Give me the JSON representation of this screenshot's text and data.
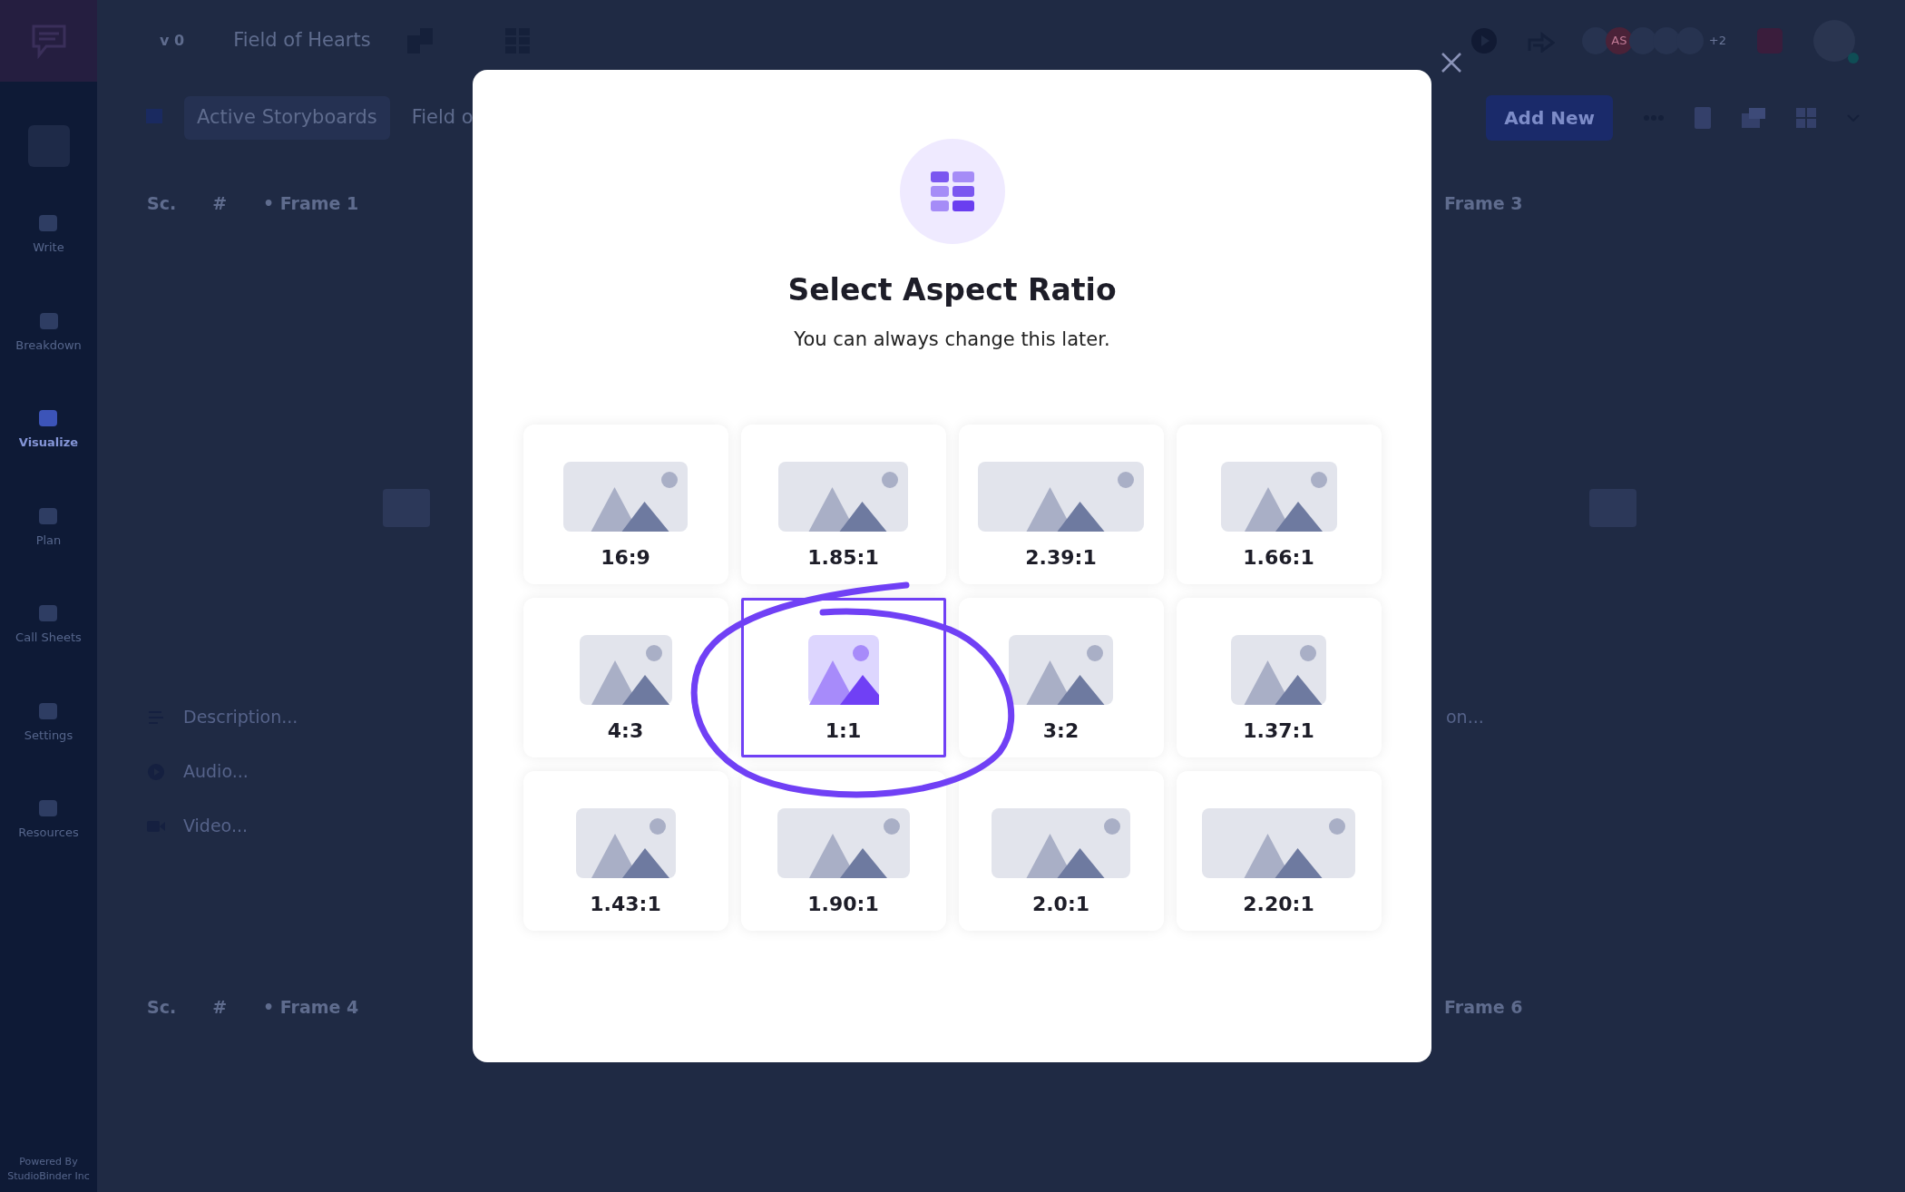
{
  "app": {
    "version": "v 0",
    "project_title": "Field of Hearts",
    "avatar_initials": "AS",
    "avatar_overflow": "+2"
  },
  "sidebar": {
    "items": [
      {
        "label": "Write",
        "selected": false
      },
      {
        "label": "Breakdown",
        "selected": false
      },
      {
        "label": "Visualize",
        "selected": true
      },
      {
        "label": "Plan",
        "selected": false
      },
      {
        "label": "Call Sheets",
        "selected": false
      },
      {
        "label": "Settings",
        "selected": false
      },
      {
        "label": "Resources",
        "selected": false
      }
    ],
    "footer": "Powered By StudioBinder Inc"
  },
  "toolbar": {
    "dropdown": "Active Storyboards",
    "breadcrumb": "Field o",
    "add_button": "Add New"
  },
  "frame_rows": [
    {
      "left": {
        "scene": "Sc.",
        "number": "#",
        "title": "• Frame 1",
        "fields": [
          {
            "kind": "description",
            "placeholder": "Description..."
          },
          {
            "kind": "audio",
            "placeholder": "Audio..."
          },
          {
            "kind": "video",
            "placeholder": "Video..."
          }
        ]
      },
      "right": {
        "title": "Frame 3",
        "fields": [
          {
            "placeholder": "on..."
          }
        ]
      }
    },
    {
      "left": {
        "scene": "Sc.",
        "number": "#",
        "title": "• Frame 4"
      },
      "right": {
        "title": "Frame 6"
      }
    }
  ],
  "modal": {
    "title": "Select Aspect Ratio",
    "subtitle": "You can always change this later.",
    "options": [
      {
        "label": "16:9",
        "selected": false
      },
      {
        "label": "1.85:1",
        "selected": false
      },
      {
        "label": "2.39:1",
        "selected": false
      },
      {
        "label": "1.66:1",
        "selected": false
      },
      {
        "label": "4:3",
        "selected": false
      },
      {
        "label": "1:1",
        "selected": true
      },
      {
        "label": "3:2",
        "selected": false
      },
      {
        "label": "1.37:1",
        "selected": false
      },
      {
        "label": "1.43:1",
        "selected": false
      },
      {
        "label": "1.90:1",
        "selected": false
      },
      {
        "label": "2.0:1",
        "selected": false
      },
      {
        "label": "2.20:1",
        "selected": false
      }
    ]
  }
}
